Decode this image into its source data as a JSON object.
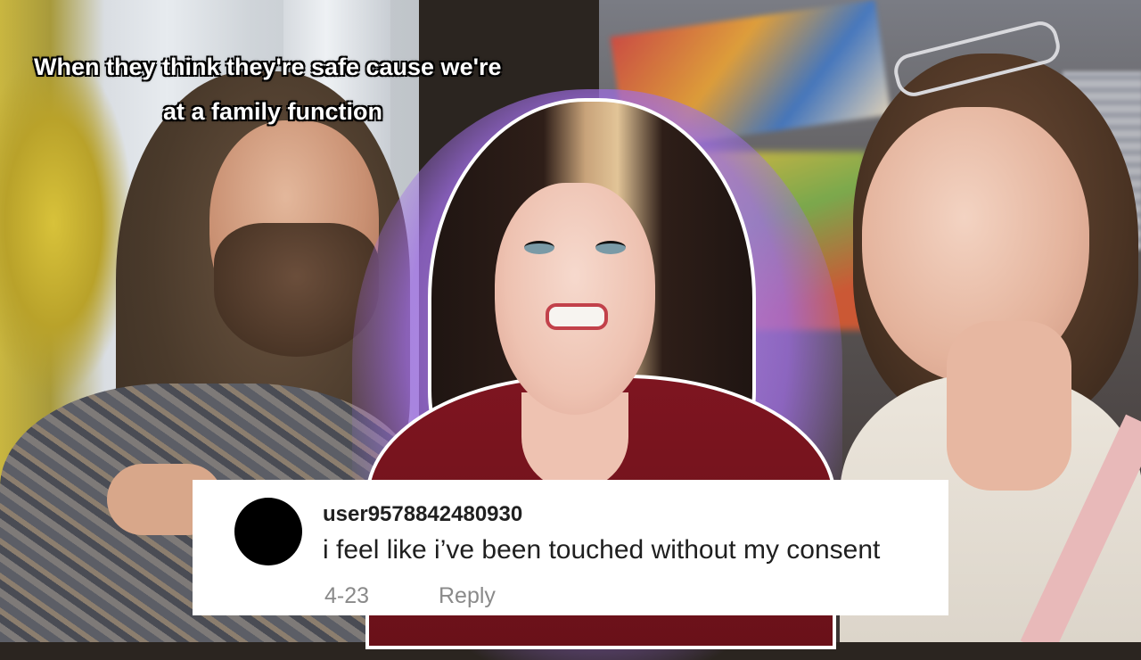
{
  "caption": {
    "line1": "When they think they're safe cause we're",
    "line2": "at a family function"
  },
  "comment": {
    "username": "user9578842480930",
    "text": "i feel like i’ve been touched without my consent",
    "date": "4-23",
    "reply_label": "Reply"
  },
  "colors": {
    "highlight_glow": "#a86ee6",
    "comment_background": "#ffffff",
    "avatar": "#000000"
  }
}
